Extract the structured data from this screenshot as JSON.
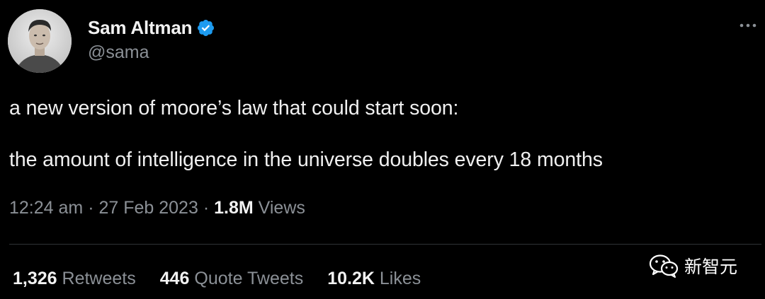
{
  "author": {
    "display_name": "Sam Altman",
    "handle": "@sama",
    "verified": true,
    "verified_color": "#1d9bf0"
  },
  "tweet": {
    "line1": "a new version of moore’s law that could start soon:",
    "line2": "the amount of intelligence in the universe doubles every 18 months"
  },
  "meta": {
    "time": "12:24 am",
    "sep1": " · ",
    "date": "27 Feb 2023",
    "sep2": " · ",
    "views_count": "1.8M",
    "views_label": " Views"
  },
  "stats": {
    "retweets_count": "1,326",
    "retweets_label": " Retweets",
    "quotes_count": "446",
    "quotes_label": " Quote Tweets",
    "likes_count": "10.2K",
    "likes_label": " Likes"
  },
  "icons": {
    "more": "more-horizontal-icon",
    "verified": "verified-badge-icon",
    "watermark_logo": "wechat-icon"
  },
  "watermark": {
    "text": "新智元"
  }
}
